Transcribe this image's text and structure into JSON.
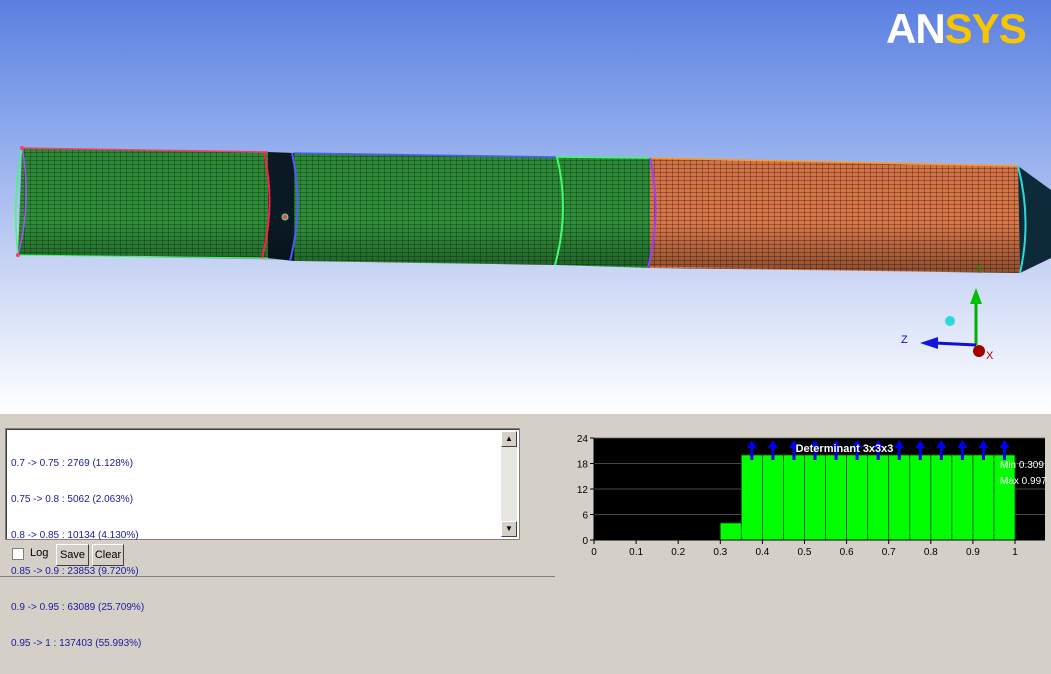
{
  "logo": {
    "part1": "AN",
    "part2": "SYS"
  },
  "triad": {
    "y": "Y",
    "z": "Z",
    "x": "X"
  },
  "log": {
    "lines": [
      "0.7 -> 0.75 : 2769 (1.128%)",
      "0.75 -> 0.8 : 5062 (2.063%)",
      "0.8 -> 0.85 : 10134 (4.130%)",
      "0.85 -> 0.9 : 23853 (9.720%)",
      "0.9 -> 0.95 : 63089 (25.709%)",
      "0.95 -> 1 : 137403 (55.993%)"
    ],
    "log_label": "Log",
    "save_label": "Save",
    "clear_label": "Clear",
    "log_checked": false
  },
  "colors": {
    "bar": "#00ff00",
    "plot_bg": "#000000",
    "marker": "#0000ee",
    "mesh_green": "#2f8f3a",
    "mesh_orange": "#d9784a"
  },
  "chart_data": {
    "type": "bar",
    "title": "Determinant 3x3x3",
    "xlim": [
      0,
      1
    ],
    "ylim": [
      0,
      24
    ],
    "x_ticks": [
      "0",
      "0.1",
      "0.2",
      "0.3",
      "0.4",
      "0.5",
      "0.6",
      "0.7",
      "0.8",
      "0.9",
      "1"
    ],
    "y_ticks": [
      "0",
      "6",
      "12",
      "18",
      "24"
    ],
    "bin_width": 0.05,
    "bins": [
      {
        "x": 0.3,
        "y": 4
      },
      {
        "x": 0.35,
        "y": 20
      },
      {
        "x": 0.4,
        "y": 20
      },
      {
        "x": 0.45,
        "y": 20
      },
      {
        "x": 0.5,
        "y": 20
      },
      {
        "x": 0.55,
        "y": 20
      },
      {
        "x": 0.6,
        "y": 20
      },
      {
        "x": 0.65,
        "y": 20
      },
      {
        "x": 0.7,
        "y": 20
      },
      {
        "x": 0.75,
        "y": 20
      },
      {
        "x": 0.8,
        "y": 20
      },
      {
        "x": 0.85,
        "y": 20
      },
      {
        "x": 0.9,
        "y": 20
      },
      {
        "x": 0.95,
        "y": 20
      }
    ],
    "clip_markers_x": [
      0.375,
      0.425,
      0.475,
      0.525,
      0.575,
      0.625,
      0.675,
      0.725,
      0.775,
      0.825,
      0.875,
      0.925,
      0.975
    ],
    "min_label": "Min 0.309",
    "max_label": "Max 0.997",
    "grid": true,
    "legend": "none"
  }
}
